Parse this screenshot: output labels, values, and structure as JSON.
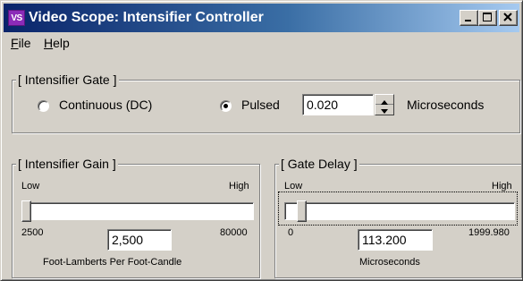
{
  "window": {
    "icon_text": "VS",
    "title": "Video Scope: Intensifier Controller"
  },
  "menu": {
    "file": {
      "accel": "F",
      "rest": "ile"
    },
    "help": {
      "accel": "H",
      "rest": "elp"
    }
  },
  "gate": {
    "caption": "[ Intensifier Gate ]",
    "continuous_label": "Continuous (DC)",
    "pulsed_label": "Pulsed",
    "selected": "pulsed",
    "value": "0.020",
    "unit": "Microseconds"
  },
  "gain": {
    "caption": "[ Intensifier Gain ]",
    "low_label": "Low",
    "high_label": "High",
    "min_label": "2500",
    "max_label": "80000",
    "value": "2,500",
    "level": 0.0,
    "unit": "Foot-Lamberts Per Foot-Candle"
  },
  "delay": {
    "caption": "[ Gate Delay ]",
    "low_label": "Low",
    "high_label": "High",
    "min_label": "0",
    "max_label": "1999.980",
    "value": "113.200",
    "level": 0.0566,
    "unit": "Microseconds"
  },
  "colors": {
    "face": "#d4d0c8",
    "title_start": "#0a246a",
    "title_end": "#a6caf0",
    "icon_bg": "#8c2bb8"
  }
}
